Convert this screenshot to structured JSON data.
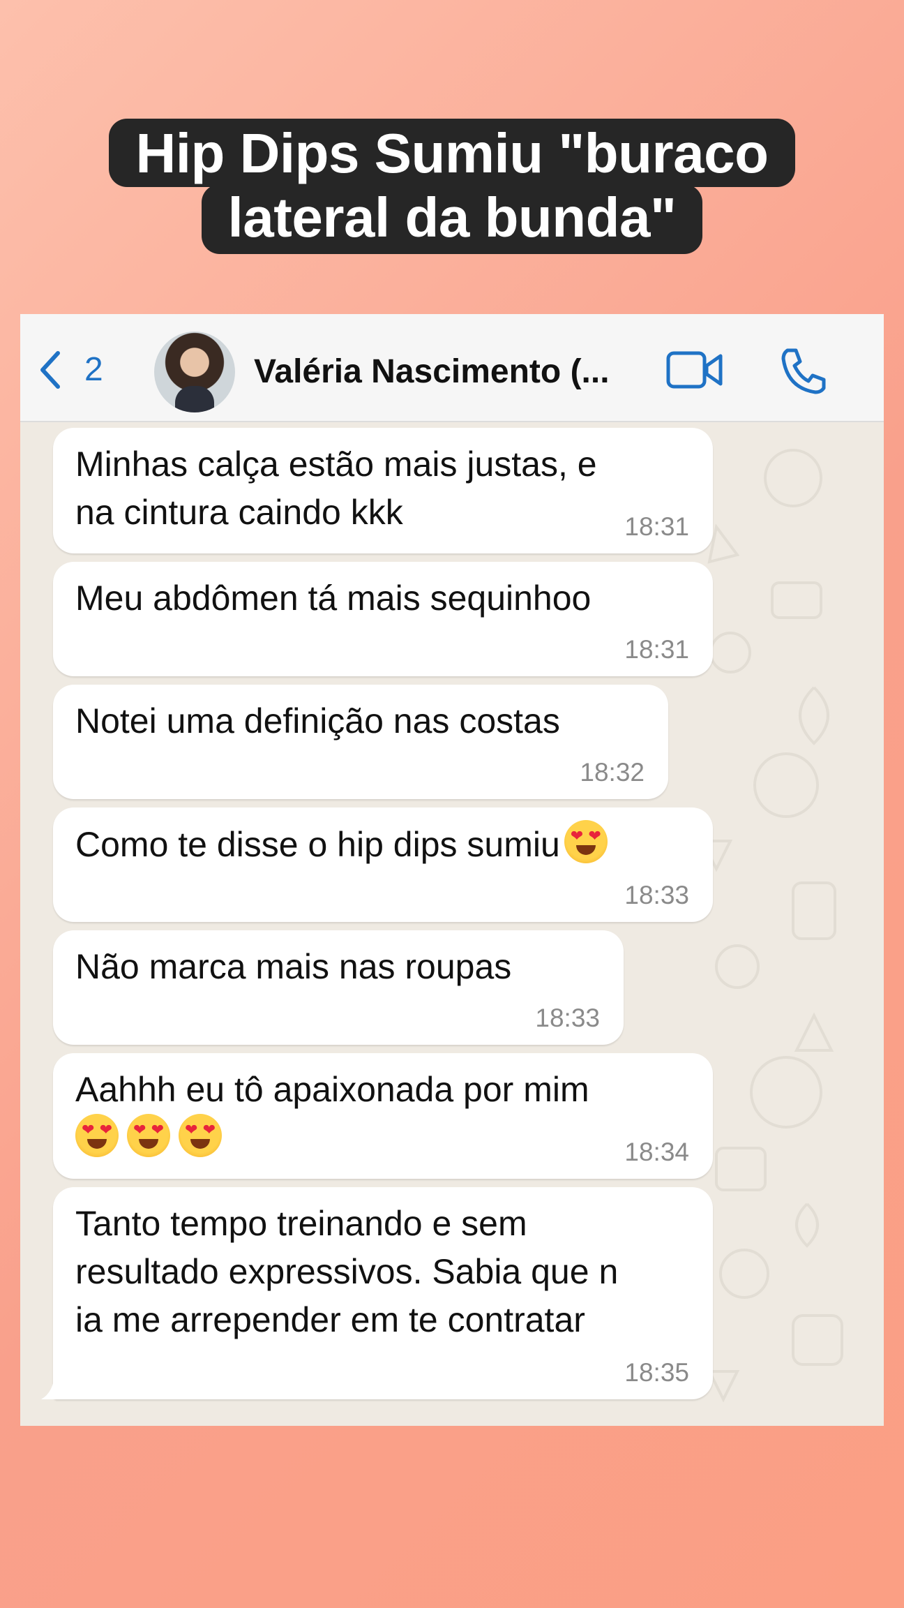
{
  "title": {
    "line1": "Hip Dips Sumiu \"buraco",
    "line2": "lateral da bunda\""
  },
  "header": {
    "back_count": "2",
    "contact_name": "Valéria Nascimento (..."
  },
  "messages": [
    {
      "text": "Minhas calça estão mais justas, e\nna cintura caindo kkk",
      "time": "18:31"
    },
    {
      "text": "Meu abdômen tá mais sequinhoo",
      "time": "18:31"
    },
    {
      "text": "Notei uma definição nas costas",
      "time": "18:32"
    },
    {
      "text": "Como te disse o hip dips sumiu",
      "time": "18:33",
      "emoji": "heart-eyes"
    },
    {
      "text": "Não marca mais nas roupas",
      "time": "18:33"
    },
    {
      "text": "Aahhh eu tô apaixonada por mim",
      "time": "18:34",
      "emoji_line": [
        "heart-eyes",
        "heart-eyes",
        "heart-eyes"
      ]
    },
    {
      "text": "Tanto tempo treinando e sem\nresultado expressivos. Sabia que n\nia me arrepender em te contratar",
      "time": "18:35"
    }
  ],
  "colors": {
    "accent": "#1f72c5",
    "chat_bg": "#efeae2",
    "bubble": "#ffffff",
    "title_bg": "#262626"
  }
}
